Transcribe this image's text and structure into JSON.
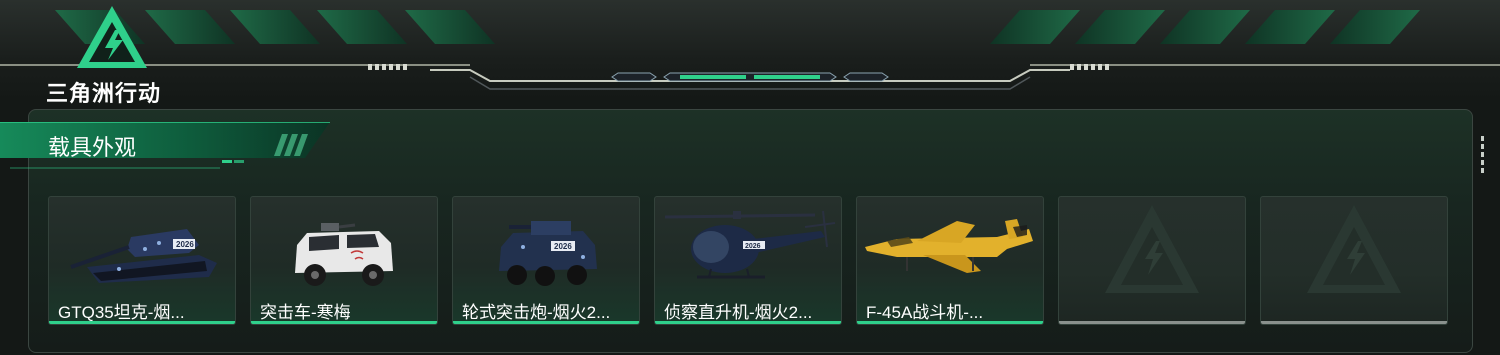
{
  "brand": {
    "name": "三角洲行动"
  },
  "section": {
    "title": "载具外观"
  },
  "colors": {
    "accent": "#2fd08b",
    "panel_bg": "#182620",
    "empty_underline": "#8a918d",
    "jet_body": "#e2b12c"
  },
  "cards": [
    {
      "label": "GTQ35坦克-烟...",
      "icon": "tank-icon",
      "empty": false
    },
    {
      "label": "突击车-寒梅",
      "icon": "assault-vehicle-icon",
      "empty": false
    },
    {
      "label": "轮式突击炮-烟火2...",
      "icon": "wheeled-gun-icon",
      "empty": false
    },
    {
      "label": "侦察直升机-烟火2...",
      "icon": "helicopter-icon",
      "empty": false
    },
    {
      "label": "F-45A战斗机-...",
      "icon": "fighter-jet-icon",
      "empty": false
    },
    {
      "label": "",
      "icon": "locked-slot-icon",
      "empty": true
    },
    {
      "label": "",
      "icon": "locked-slot-icon",
      "empty": true
    }
  ]
}
